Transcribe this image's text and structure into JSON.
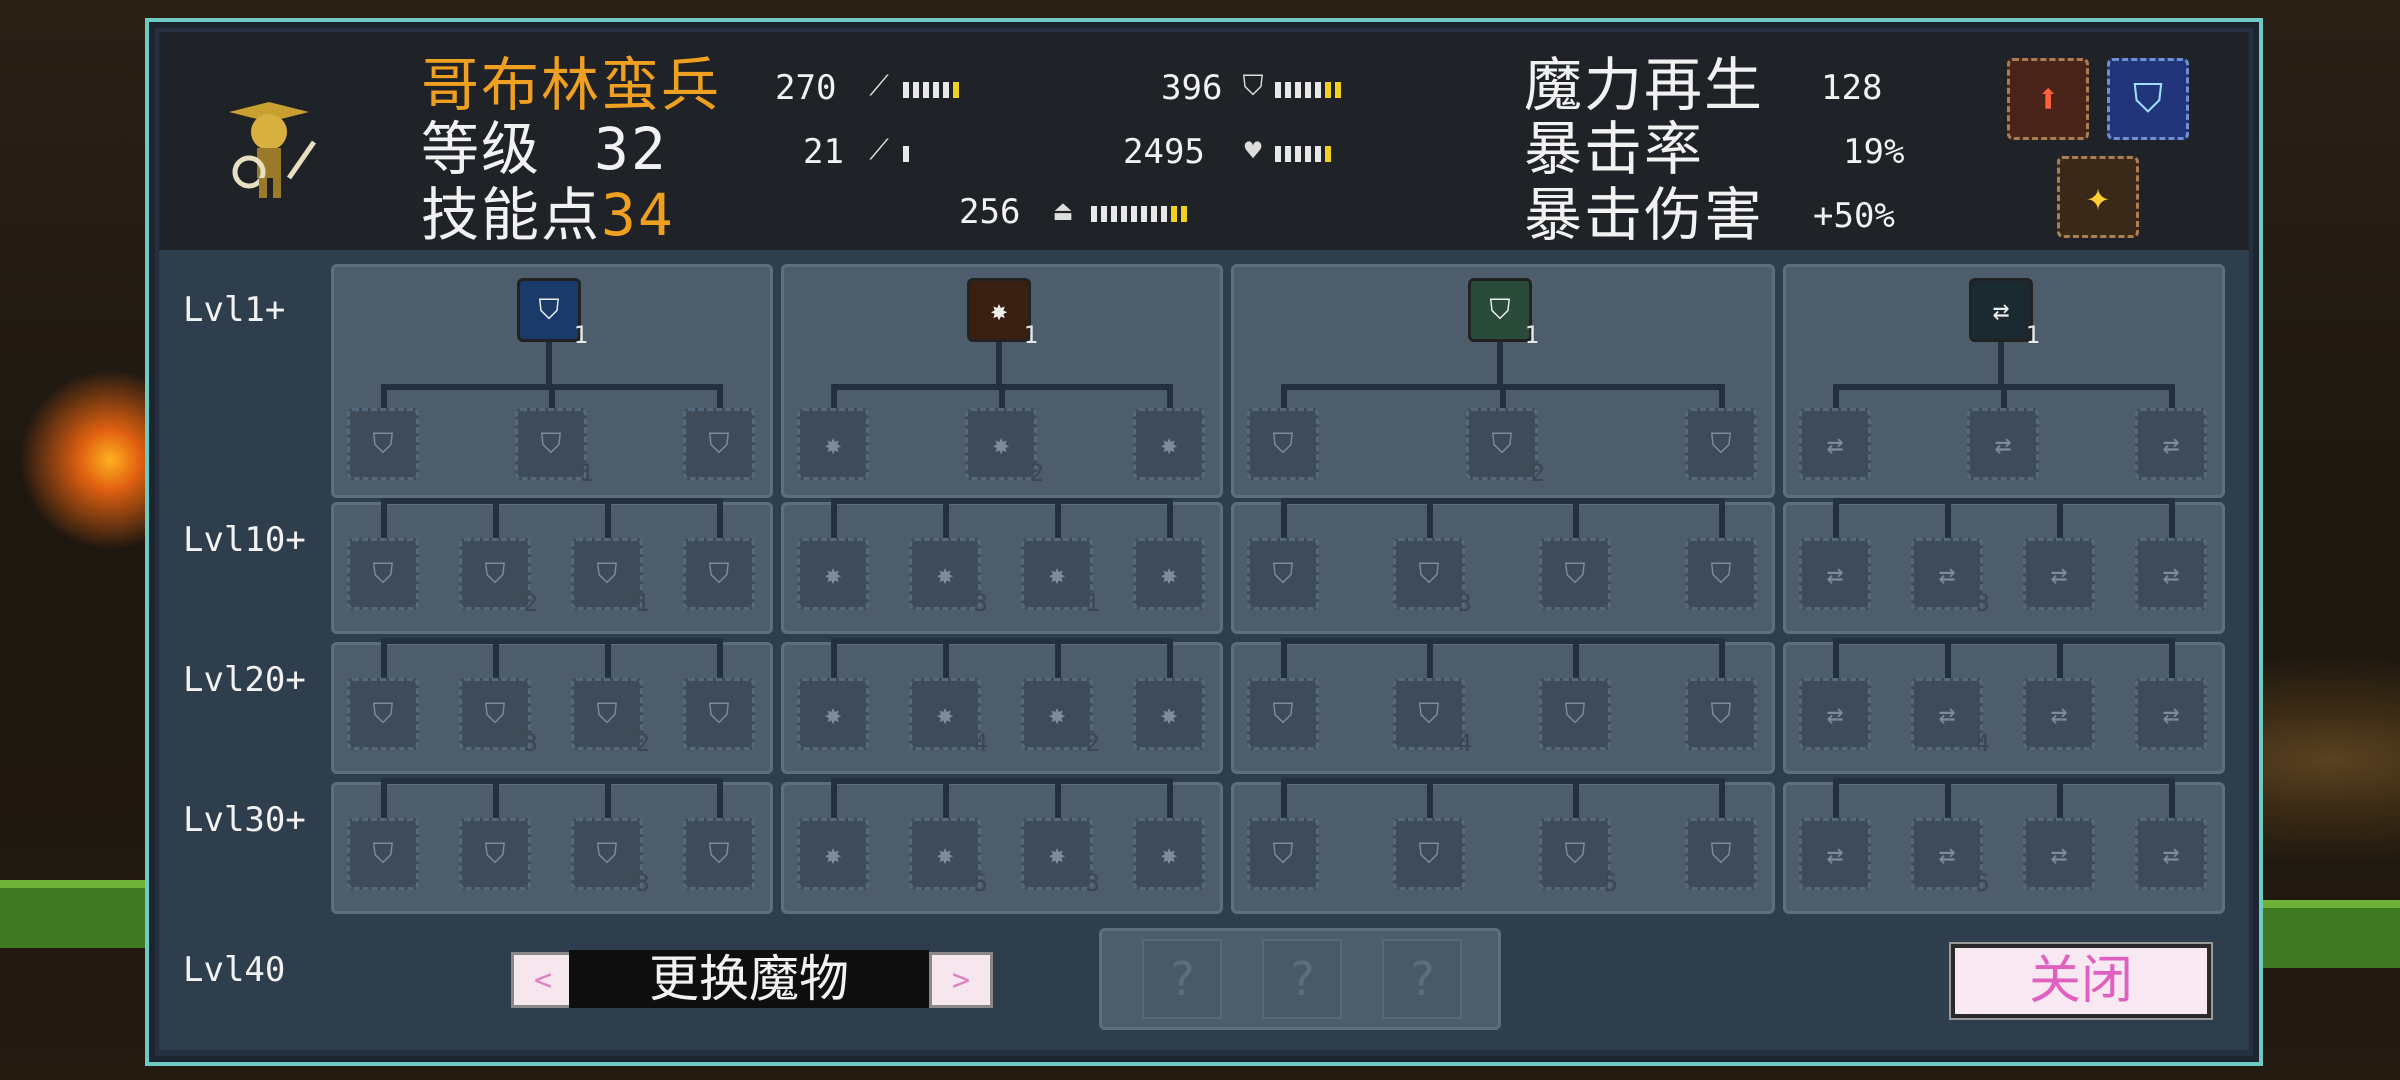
{
  "monster": {
    "name": "哥布林蛮兵",
    "level_label": "等级",
    "level": "32",
    "skill_points_label": "技能点",
    "skill_points": "34"
  },
  "stats": {
    "attack": "270",
    "defense": "396",
    "magic": "21",
    "hp": "2495",
    "mana": "256",
    "mana_regen_label": "魔力再生",
    "mana_regen": "128",
    "crit_rate_label": "暴击率",
    "crit_rate": "19%",
    "crit_damage_label": "暴击伤害",
    "crit_damage": "+50%"
  },
  "level_labels": [
    "Lvl1+",
    "Lvl10+",
    "Lvl20+",
    "Lvl30+",
    "Lvl40"
  ],
  "skill_tree": {
    "top_counts": [
      "1",
      "1",
      "1",
      "1"
    ],
    "lvl1_counts": [
      [
        "",
        "1",
        ""
      ],
      [
        "",
        "2",
        ""
      ],
      [
        "",
        "2",
        ""
      ],
      [
        "",
        "",
        ""
      ]
    ],
    "lvl10_counts": [
      [
        "",
        "2",
        "1",
        ""
      ],
      [
        "",
        "3",
        "1",
        ""
      ],
      [
        "",
        "3",
        "",
        ""
      ],
      [
        "",
        "3",
        "",
        ""
      ]
    ],
    "lvl20_counts": [
      [
        "",
        "3",
        "2",
        ""
      ],
      [
        "",
        "4",
        "2",
        ""
      ],
      [
        "",
        "4",
        "",
        ""
      ],
      [
        "",
        "4",
        "",
        ""
      ]
    ],
    "lvl30_counts": [
      [
        "",
        "",
        "3",
        ""
      ],
      [
        "",
        "5",
        "3",
        ""
      ],
      [
        "",
        "",
        "5",
        ""
      ],
      [
        "",
        "5",
        "",
        ""
      ]
    ]
  },
  "bottom": {
    "prev": "<",
    "switch_label": "更换魔物",
    "next": ">",
    "locked": [
      "?",
      "?",
      "?"
    ],
    "close_label": "关闭"
  },
  "colors": {
    "accent_orange": "#f0a020",
    "frame": "#6ecbc3",
    "close_text": "#e060c0"
  }
}
